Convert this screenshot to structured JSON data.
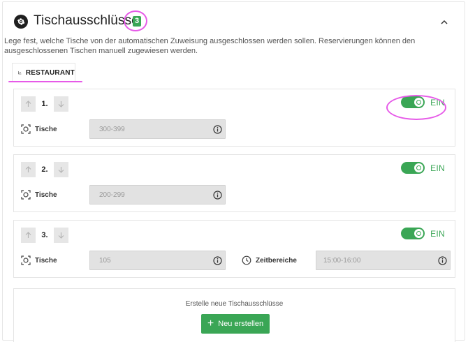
{
  "header": {
    "title": "Tischausschlüsse",
    "badge": "3",
    "icon": "gear-icon",
    "collapse_icon": "chevron-up-icon"
  },
  "description": "Lege fest, welche Tische von der automatischen Zuweisung ausgeschlossen werden sollen. Reservierungen können den ausgeschlossenen Tischen manuell zugewiesen werden.",
  "tabs": [
    {
      "label": "RESTAURANT",
      "icon": "chart-line-icon",
      "active": true
    }
  ],
  "rules": [
    {
      "order": "1.",
      "toggle_label": "EIN",
      "tables_label": "Tische",
      "tables_value": "300-399"
    },
    {
      "order": "2.",
      "toggle_label": "EIN",
      "tables_label": "Tische",
      "tables_value": "200-299"
    },
    {
      "order": "3.",
      "toggle_label": "EIN",
      "tables_label": "Tische",
      "tables_value": "105",
      "time_label": "Zeitbereiche",
      "time_value": "15:00-16:00"
    }
  ],
  "create": {
    "prompt": "Erstelle neue Tischausschlüsse",
    "button_label": "Neu erstellen"
  },
  "colors": {
    "accent_green": "#3aa655",
    "highlight": "#e65ae8"
  }
}
